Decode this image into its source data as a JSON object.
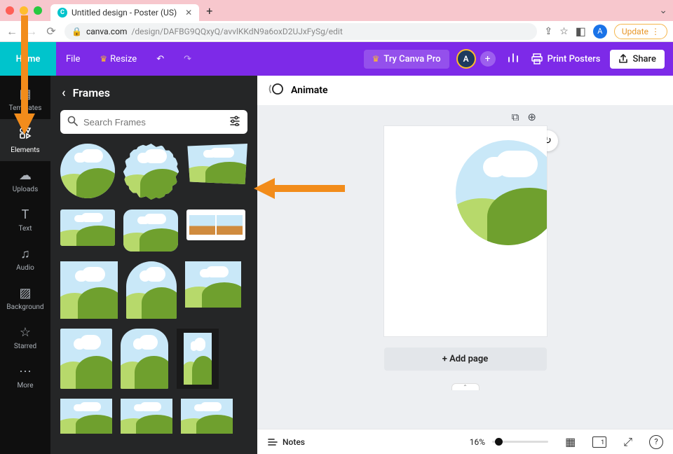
{
  "browser": {
    "tab_title": "Untitled design - Poster (US)",
    "url_domain": "canva.com",
    "url_path": "/design/DAFBG9QQxyQ/avvlKKdN9a6oxD2UJxFySg/edit",
    "update_label": "Update",
    "avatar_letter": "A"
  },
  "appbar": {
    "home": "Home",
    "file": "File",
    "resize": "Resize",
    "try_pro": "Try Canva Pro",
    "print": "Print Posters",
    "share": "Share",
    "user_initial": "A"
  },
  "rail": {
    "items": [
      {
        "id": "templates",
        "label": "Templates"
      },
      {
        "id": "elements",
        "label": "Elements"
      },
      {
        "id": "uploads",
        "label": "Uploads"
      },
      {
        "id": "text",
        "label": "Text"
      },
      {
        "id": "audio",
        "label": "Audio"
      },
      {
        "id": "background",
        "label": "Background"
      },
      {
        "id": "starred",
        "label": "Starred"
      },
      {
        "id": "more",
        "label": "More"
      }
    ]
  },
  "sidepanel": {
    "title": "Frames",
    "search_placeholder": "Search Frames"
  },
  "toolbar": {
    "animate": "Animate"
  },
  "canvas": {
    "add_page": "+ Add page"
  },
  "bottombar": {
    "notes": "Notes",
    "zoom": "16%",
    "page_indicator": "1"
  }
}
